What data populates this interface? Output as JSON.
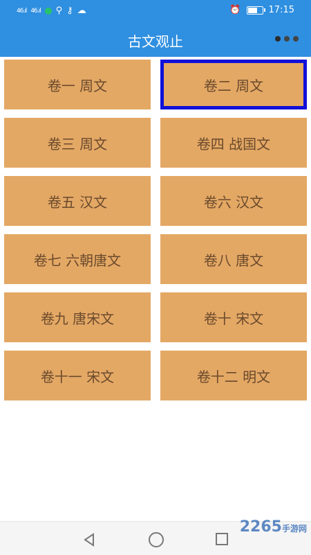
{
  "status_bar": {
    "signal1": "46.ıl",
    "signal2": "46.ıl",
    "time": "17:15"
  },
  "app_bar": {
    "title": "古文观止"
  },
  "volumes": [
    {
      "label": "卷一  周文"
    },
    {
      "label": "卷二  周文"
    },
    {
      "label": "卷三  周文"
    },
    {
      "label": "卷四  战国文"
    },
    {
      "label": "卷五  汉文"
    },
    {
      "label": "卷六  汉文"
    },
    {
      "label": "卷七  六朝唐文"
    },
    {
      "label": "卷八  唐文"
    },
    {
      "label": "卷九  唐宋文"
    },
    {
      "label": "卷十  宋文"
    },
    {
      "label": "卷十一 宋文"
    },
    {
      "label": "卷十二 明文"
    }
  ],
  "watermark": {
    "text": "2265",
    "sub": "手游网"
  },
  "colors": {
    "primary": "#2f8fe0",
    "card": "#e4a865",
    "card_text": "#6a4a2c",
    "selected_border": "#1010d8"
  },
  "icons": {
    "more": "overflow-dots-icon",
    "back": "back-triangle-icon",
    "home": "home-circle-icon",
    "recent": "recent-square-icon"
  }
}
